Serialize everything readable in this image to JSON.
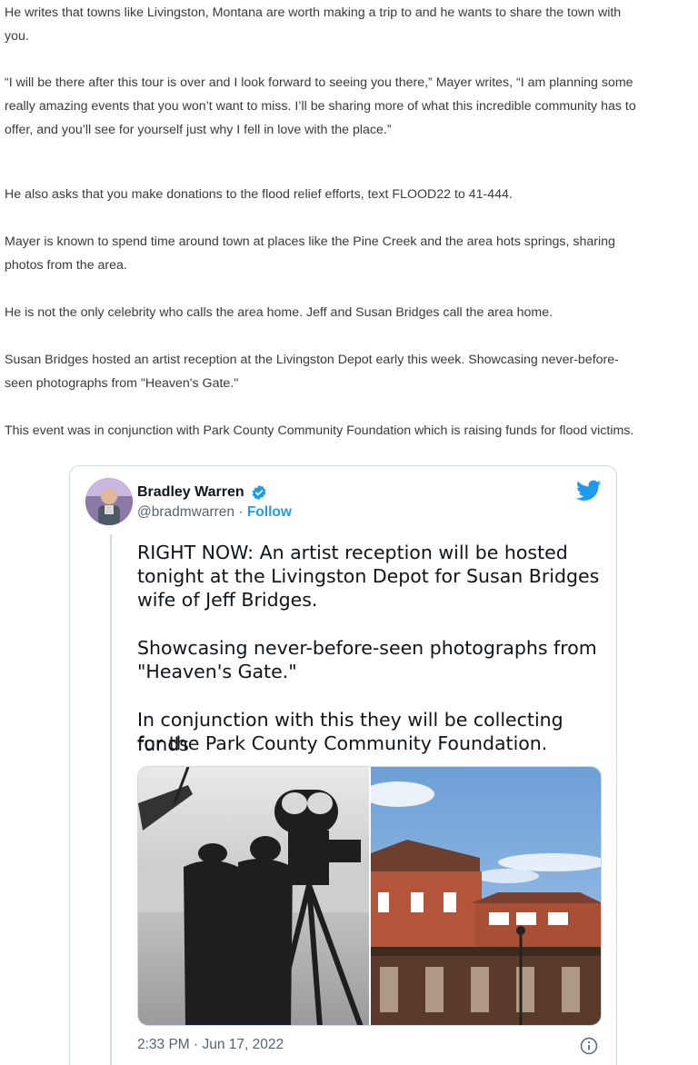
{
  "article": {
    "paragraphs": [
      "He writes that towns like Livingston, Montana are worth making a trip to and he wants to share the town with",
      "you.",
      "“I will be there after this tour is over and I look forward to seeing you there,” Mayer writes, “I am planning some",
      "really amazing events that you won’t want to miss. I’ll be sharing more of what this incredible community has to",
      "offer, and you’ll see for yourself just why I fell in love with the place.”",
      "He also asks that you make donations to the flood relief efforts, text FLOOD22 to 41-444.",
      "Mayer is known to spend time around town at places like the Pine Creek and the area hots springs, sharing",
      "photos from the area.",
      "He is not the only celebrity who calls the area home. Jeff and Susan Bridges call the area home.",
      "Susan Bridges hosted an artist reception at the Livingston Depot early this week. Showcasing never-before-",
      "seen photographs from \"Heaven's Gate.\"",
      "This event was in conjunction with Park County Community Foundation which is raising funds for flood victims."
    ]
  },
  "tweet": {
    "author_name": "Bradley Warren",
    "handle": "@bradmwarren",
    "separator": " · ",
    "follow_label": "Follow",
    "text_lines": [
      "RIGHT NOW: An artist reception will be hosted",
      "tonight at the Livingston Depot for Susan Bridges",
      "wife of Jeff Bridges.",
      "Showcasing never-before-seen photographs from",
      "\"Heaven's Gate.\"",
      "In conjunction with this they will be collecting funds",
      "for the Park County Community Foundation."
    ],
    "timestamp": "2:33 PM · Jun 17, 2022",
    "icons": [
      "verified-badge-icon",
      "twitter-bird-icon",
      "info-icon"
    ],
    "colors": {
      "accent": "#1d9bf0",
      "text": "#0f1419",
      "muted": "#536471",
      "border": "#cfd9de"
    }
  }
}
